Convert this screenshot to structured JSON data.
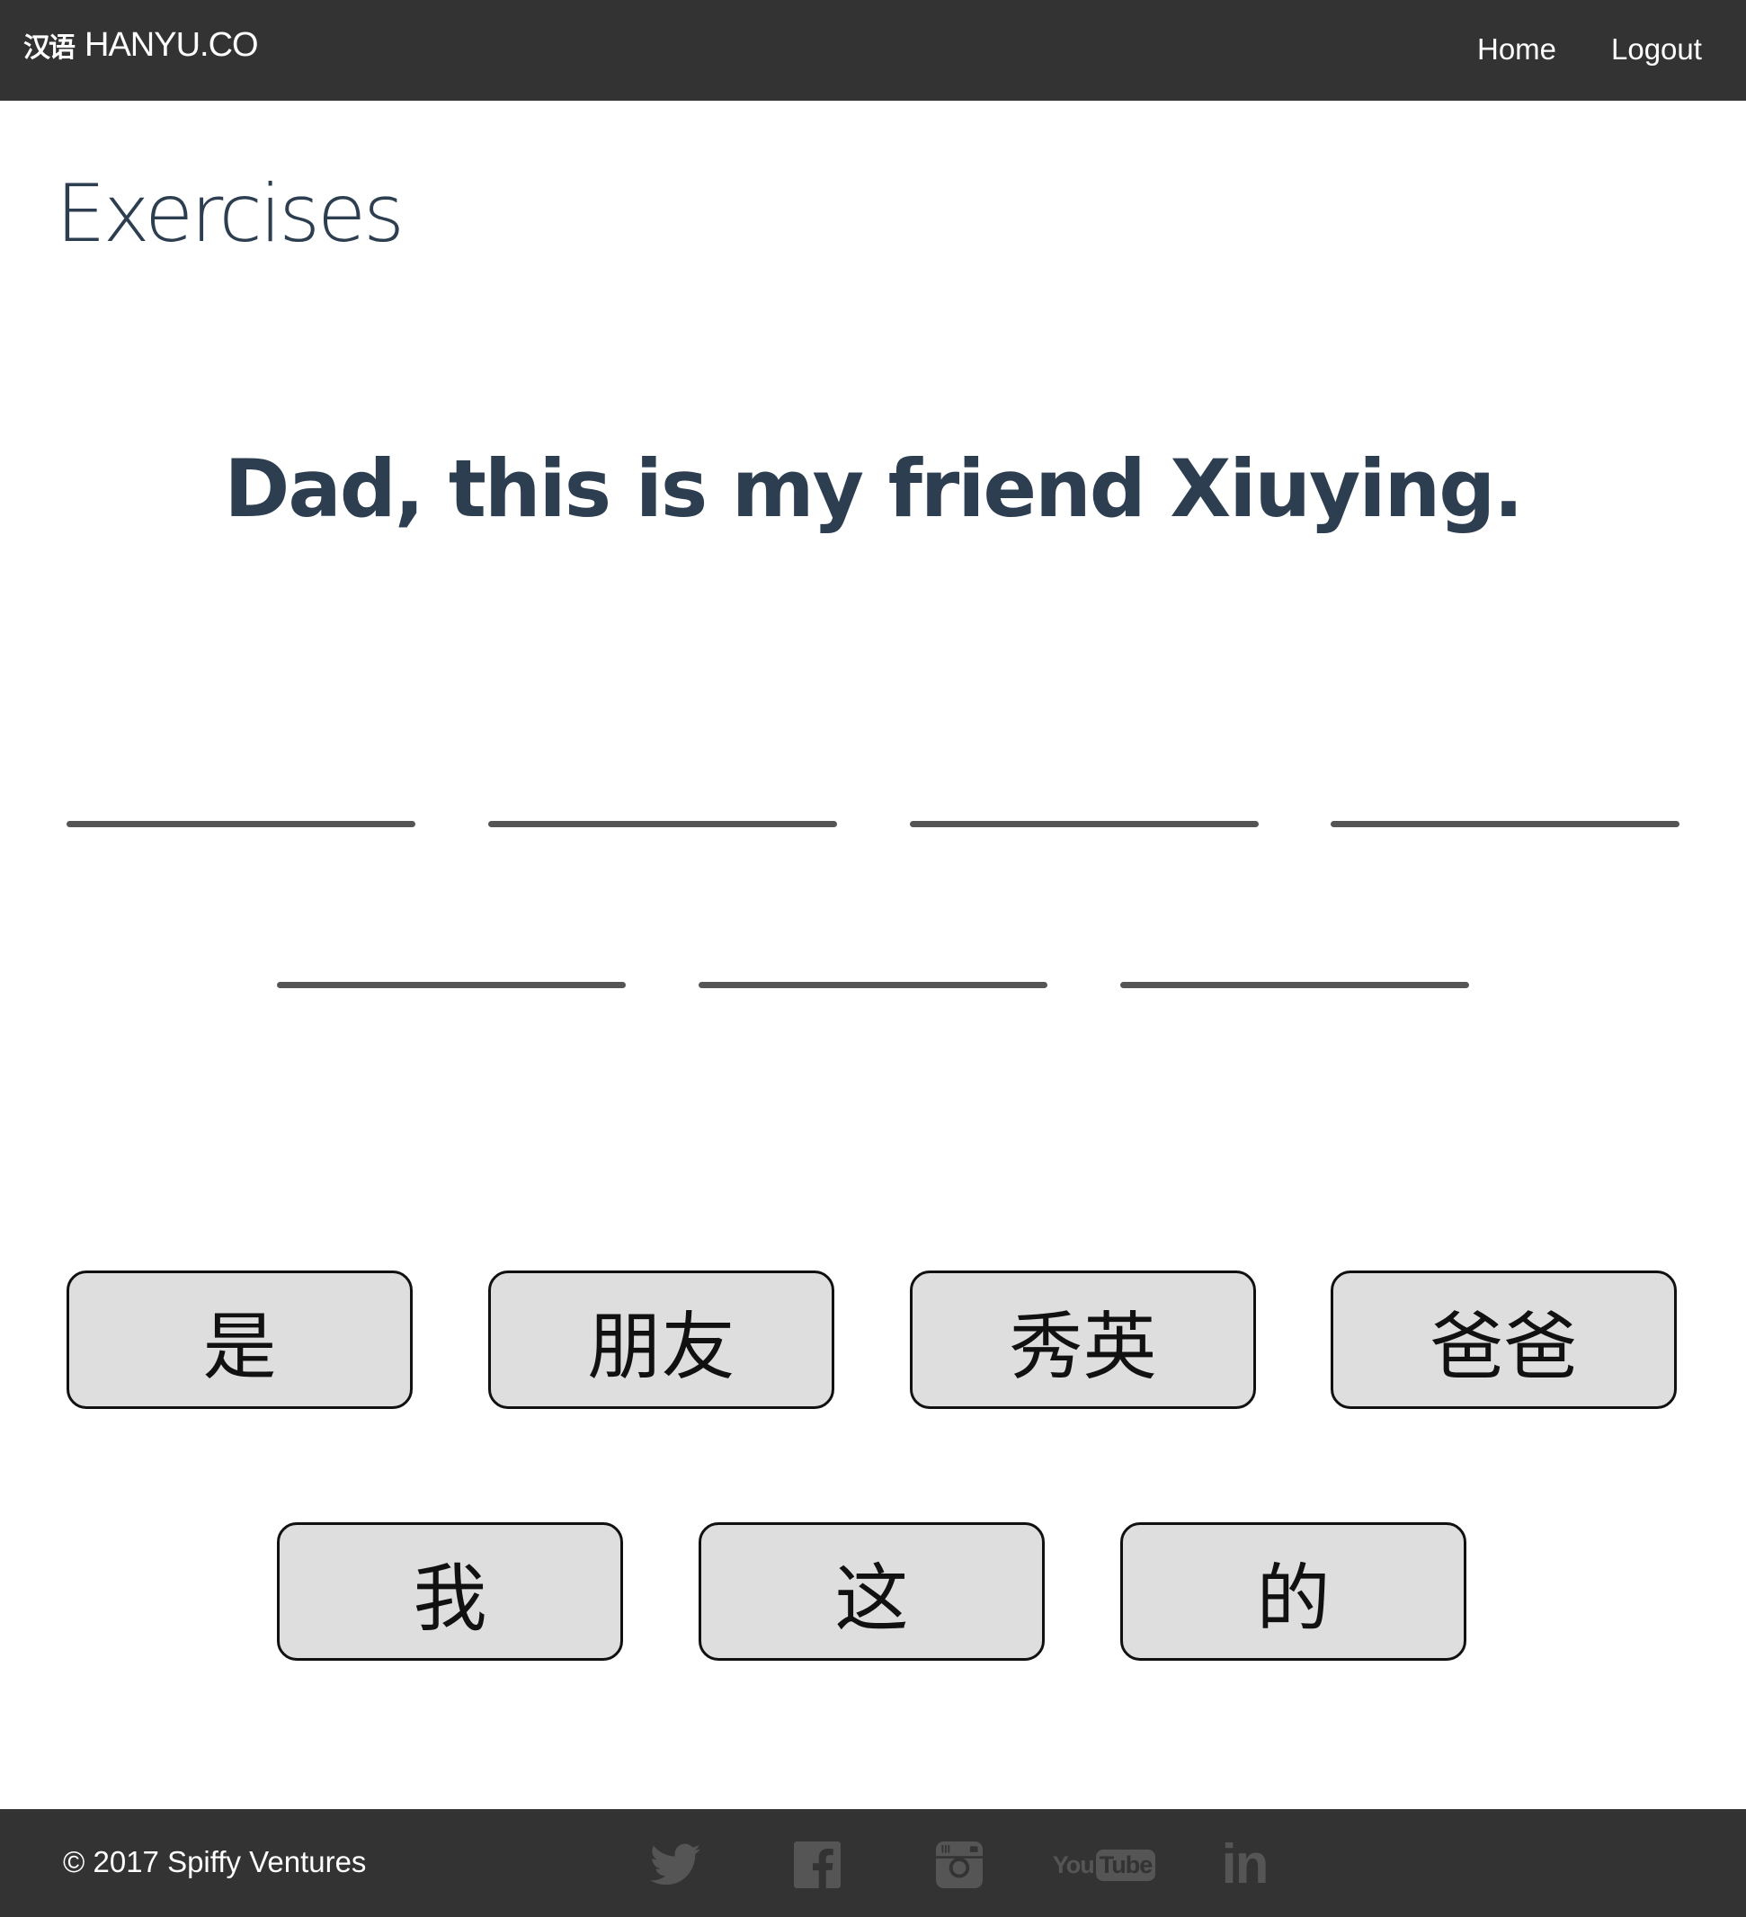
{
  "header": {
    "brand_cjk": "汉语",
    "brand_name": "HANYU.CO",
    "nav": {
      "home": "Home",
      "logout": "Logout"
    }
  },
  "main": {
    "title": "Exercises",
    "prompt": "Dad, this is my friend Xiuying.",
    "answer_slots": 7,
    "word_tiles": [
      "是",
      "朋友",
      "秀英",
      "爸爸",
      "我",
      "这",
      "的"
    ]
  },
  "footer": {
    "copyright": "© 2017 Spiffy Ventures",
    "social_icons": [
      "twitter-icon",
      "facebook-icon",
      "instagram-icon",
      "youtube-icon",
      "linkedin-icon"
    ],
    "youtube_label_you": "You",
    "youtube_label_tube": "Tube",
    "linkedin_label": "in"
  },
  "colors": {
    "header_bg": "#333333",
    "footer_bg": "#333333",
    "title_color": "#2c3e50",
    "tile_bg": "#dedede",
    "icon_color": "#555555"
  }
}
